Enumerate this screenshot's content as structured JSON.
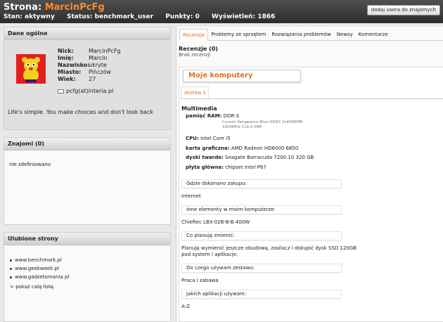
{
  "header": {
    "title_prefix": "Strona:",
    "username": "MarcinPcFg",
    "stan_label": "Stan:",
    "stan_value": "aktywny",
    "status_label": "Status:",
    "status_value": "benchmark_user",
    "punkty_label": "Punkty:",
    "punkty_value": "0",
    "wysw_label": "Wyświetleń:",
    "wysw_value": "1866",
    "add_friend_label": "dodaj usera do znajomych"
  },
  "general": {
    "title": "Dane ogólne",
    "fields": [
      {
        "label": "Nick:",
        "value": "MarcinPcFg"
      },
      {
        "label": "Imię:",
        "value": "Marcin"
      },
      {
        "label": "Nazwisko:",
        "value": "ukryte"
      },
      {
        "label": "Miasto:",
        "value": "Pińczów"
      },
      {
        "label": "Wiek:",
        "value": "27"
      }
    ],
    "email": "pcfg(at)interia.pl",
    "motto": "Life's simple. You make choices and don't look back"
  },
  "friends": {
    "title": "Znajomi (0)",
    "empty": "nie zdefiniowano"
  },
  "favorites": {
    "title": "Ulubione strony",
    "sites": [
      "www.benchmark.pl",
      "www.geekweek.pl",
      "www.gadzetomania.pl"
    ],
    "show_all": "> pokaż całą listę"
  },
  "tabs": [
    "Recenzje",
    "Problemy ze sprzętem",
    "Rozwiązania problemów",
    "Newsy",
    "Komentarze"
  ],
  "reviews": {
    "title": "Recenzje (0)",
    "subtitle": "Brak recenzji"
  },
  "computers": {
    "title": "Moje komputery",
    "set_tab": "zestaw 1",
    "category": "Multimedia",
    "specs": {
      "ram_label": "pamięć RAM:",
      "ram_value": "DDR-3",
      "ram_sub1": "Corsair Vengeance Blue DDR3 2x4096MB",
      "ram_sub2": "1600MHz CL9.0 XMP",
      "cpu_label": "CPU:",
      "cpu_value": "Intel Core i5",
      "gpu_label": "karta graficzna:",
      "gpu_value": "AMD Radeon HD6000 6850",
      "hdd_label": "dyski twarde:",
      "hdd_value": "Seagate Barracuda 7200.10 320 GB",
      "mb_label": "płyta główna:",
      "mb_value": "chipset Intel P67"
    },
    "qa": [
      {
        "q": "Gdzie dokonano zakupu:",
        "a": "Internet"
      },
      {
        "q": "Inne elementy w moim komputerze:",
        "a": "Chieftec LBX-02B-B-B 400W"
      },
      {
        "q": "Co planuję zmienić:",
        "a": "Planuję wymienić jeszcze obudowę, zasilacz i dokupić dysk SSD 120GB",
        "a2": "pod system i aplikacje."
      },
      {
        "q": "Do czego używam zestawu:",
        "a": "Praca i zabawa"
      },
      {
        "q": "Jakich aplikacji używam:",
        "a": "A-Z"
      }
    ]
  }
}
